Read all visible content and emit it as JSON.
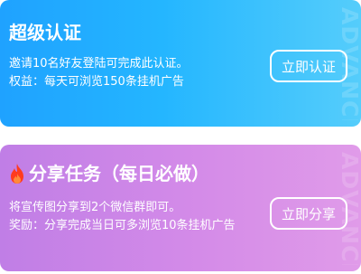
{
  "super_verify": {
    "title": "超级认证",
    "line1": "邀请10名好友登陆可完成此认证。",
    "line2": "权益：每天可浏览150条挂机广告",
    "button_label": "立即认证",
    "watermark": "ADVANCED",
    "background_colors": [
      "#1fa2ff",
      "#55cdfb"
    ]
  },
  "daily_share": {
    "title": "分享任务（每日必做）",
    "icon": "fire-icon",
    "line1": "将宣传图分享到2个微信群即可。",
    "line2": "奖励：分享完成当日可多浏览10条挂机广告",
    "button_label": "立即分享",
    "watermark": "ADVANCED",
    "background_colors": [
      "#c07ee6",
      "#e09be9"
    ]
  }
}
